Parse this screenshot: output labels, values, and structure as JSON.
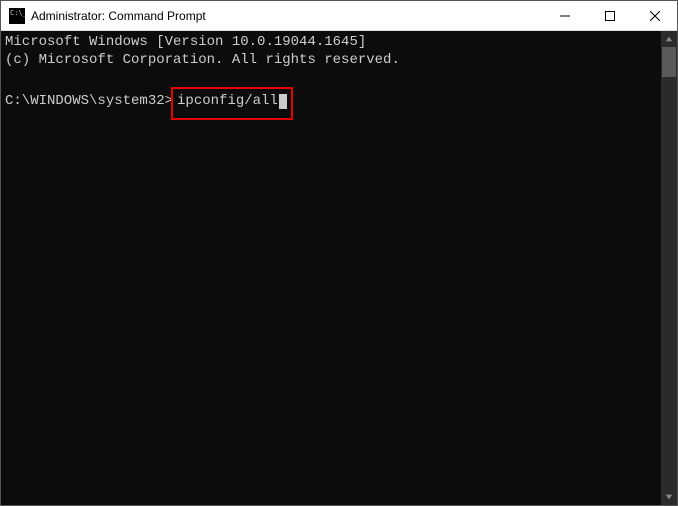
{
  "window": {
    "title": "Administrator: Command Prompt"
  },
  "terminal": {
    "line1": "Microsoft Windows [Version 10.0.19044.1645]",
    "line2": "(c) Microsoft Corporation. All rights reserved.",
    "prompt": "C:\\WINDOWS\\system32>",
    "command": "ipconfig/all"
  }
}
